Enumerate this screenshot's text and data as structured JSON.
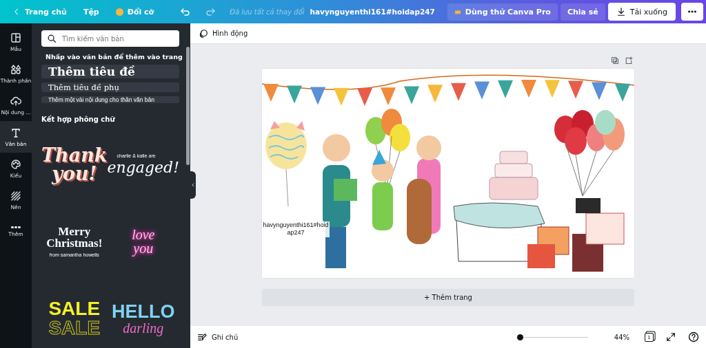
{
  "topbar": {
    "back": "Trang chủ",
    "menu": [
      "Tệp"
    ],
    "resize": "Đổi cỡ",
    "save_status": "Đã lưu tất cả thay đổi",
    "design_title": "havynguyenthi161#hoidap247",
    "pro": "Dùng thử Canva Pro",
    "share": "Chia sẻ",
    "download": "Tải xuống"
  },
  "rail": [
    {
      "label": "Mẫu",
      "selected": false
    },
    {
      "label": "Thành phần",
      "selected": false
    },
    {
      "label": "Nội dung ...",
      "selected": false
    },
    {
      "label": "Văn bản",
      "selected": true
    },
    {
      "label": "Kiểu",
      "selected": false
    },
    {
      "label": "Nền",
      "selected": false
    },
    {
      "label": "Thêm",
      "selected": false
    }
  ],
  "panel": {
    "search": {
      "placeholder": "Tìm kiếm văn bản"
    },
    "hint": "Nhấp vào văn bản để thêm vào trang",
    "presets": [
      {
        "kind": "heading",
        "label": "Thêm tiêu đề"
      },
      {
        "kind": "subheading",
        "label": "Thêm tiêu đề phụ"
      },
      {
        "kind": "body",
        "label": "Thêm một vài nội dung cho thân văn bản"
      }
    ],
    "section": "Kết hợp phông chữ",
    "combos": [
      {
        "lines": [
          {
            "kind": "retro",
            "text": "Thank"
          },
          {
            "kind": "retro",
            "text": "you!"
          }
        ]
      },
      {
        "lines": [
          {
            "kind": "tiny",
            "text": "charlie & katie are"
          },
          {
            "kind": "script",
            "text": "engaged!"
          }
        ]
      },
      {
        "lines": [
          {
            "kind": "brush",
            "text": "Merry"
          },
          {
            "kind": "brush",
            "text": "Christmas!"
          },
          {
            "kind": "caption",
            "text": "from samantha howells"
          }
        ]
      },
      {
        "lines": [
          {
            "kind": "neon",
            "text": "love"
          },
          {
            "kind": "neon",
            "text": "you"
          }
        ]
      },
      {
        "lines": [
          {
            "kind": "block",
            "text": "SALE"
          },
          {
            "kind": "outline",
            "text": "SALE"
          }
        ]
      },
      {
        "lines": [
          {
            "kind": "hello",
            "text": "HELLO"
          },
          {
            "kind": "pinkscript",
            "text": "darling"
          }
        ]
      }
    ]
  },
  "toolbar": {
    "animate": "Hình động"
  },
  "page": {
    "caption": "havynguyenthi161#hoidap247"
  },
  "add_page": "+ Thêm trang",
  "footer": {
    "notes": "Ghi chú",
    "zoom": {
      "level": 0.05
    },
    "zoom_reading": "44%",
    "page_count": "1"
  }
}
